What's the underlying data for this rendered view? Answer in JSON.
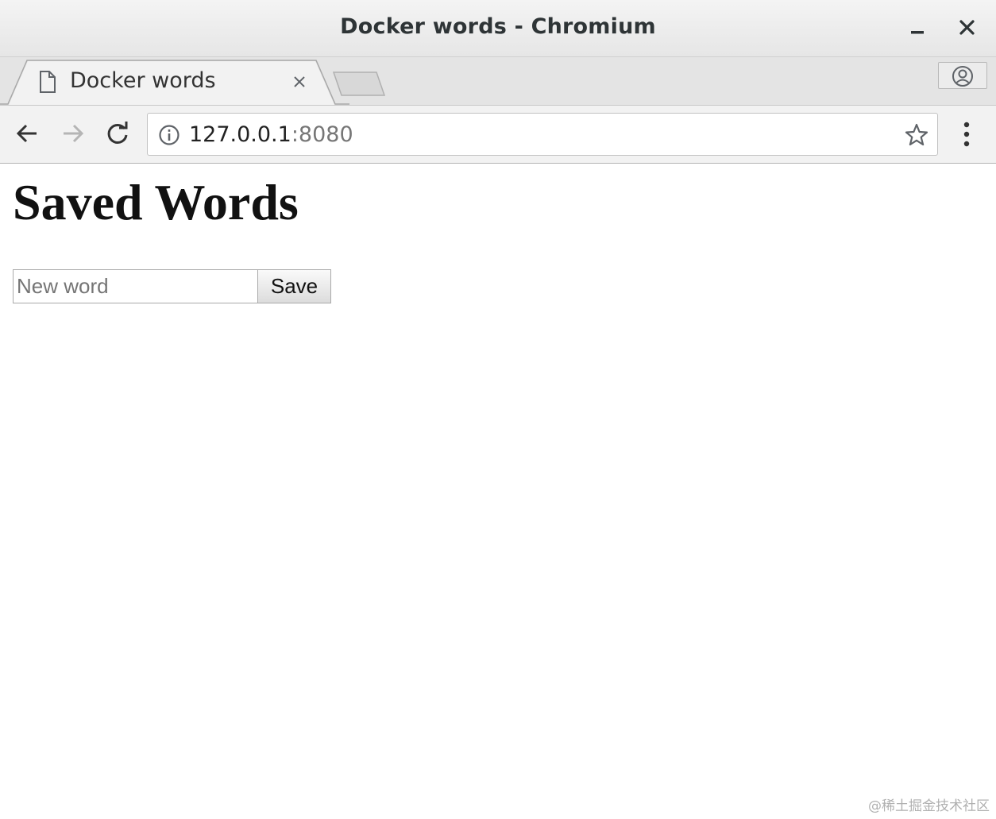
{
  "window": {
    "title": "Docker words - Chromium"
  },
  "tabs": [
    {
      "label": "Docker words",
      "active": true
    }
  ],
  "toolbar": {
    "url_host": "127.0.0.1",
    "url_port": ":8080"
  },
  "page": {
    "heading": "Saved Words",
    "input_placeholder": "New word",
    "input_value": "",
    "save_label": "Save"
  },
  "watermark": "@稀土掘金技术社区",
  "icons": {
    "minimize": "minimize-icon",
    "close": "close-icon",
    "favicon": "page-icon",
    "tab_close": "x-icon",
    "profile": "person-icon",
    "back": "arrow-left-icon",
    "forward": "arrow-right-icon",
    "reload": "reload-icon",
    "site_info": "info-icon",
    "bookmark": "star-icon",
    "menu": "kebab-menu-icon"
  },
  "colors": {
    "titlebar": "#e6e6e6",
    "tabstrip": "#e4e4e4",
    "toolbar": "#f2f2f2",
    "url_port": "#767676",
    "forward_disabled": "#b5b5b5"
  }
}
